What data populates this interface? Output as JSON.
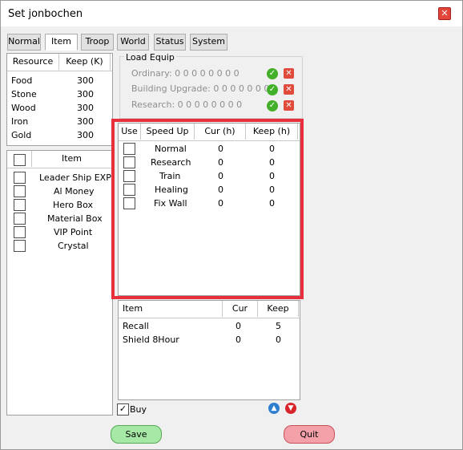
{
  "window": {
    "title": "Set jonbochen"
  },
  "tabs": [
    "Normal",
    "Item",
    "Troop",
    "World",
    "Status",
    "System"
  ],
  "resources": {
    "headers": [
      "Resource",
      "Keep (K)"
    ],
    "rows": [
      {
        "name": "Food",
        "keep": "300"
      },
      {
        "name": "Stone",
        "keep": "300"
      },
      {
        "name": "Wood",
        "keep": "300"
      },
      {
        "name": "Iron",
        "keep": "300"
      },
      {
        "name": "Gold",
        "keep": "300"
      }
    ]
  },
  "items_list": {
    "header": "Item",
    "rows": [
      "Leader Ship EXP",
      "Al Money",
      "Hero Box",
      "Material Box",
      "VIP Point",
      "Crystal"
    ]
  },
  "load_equip": {
    "label": "Load Equip",
    "rows": [
      {
        "label": "Ordinary: 0 0 0 0 0 0 0 0"
      },
      {
        "label": "Building Upgrade: 0 0 0 0 0 0 0"
      },
      {
        "label": "Research: 0 0 0 0 0 0 0 0"
      }
    ]
  },
  "speedup": {
    "headers": [
      "Use",
      "Speed Up",
      "Cur (h)",
      "Keep (h)"
    ],
    "rows": [
      {
        "name": "Normal",
        "cur": "0",
        "keep": "0"
      },
      {
        "name": "Research",
        "cur": "0",
        "keep": "0"
      },
      {
        "name": "Train",
        "cur": "0",
        "keep": "0"
      },
      {
        "name": "Healing",
        "cur": "0",
        "keep": "0"
      },
      {
        "name": "Fix Wall",
        "cur": "0",
        "keep": "0"
      }
    ]
  },
  "consumables": {
    "headers": [
      "Item",
      "Cur",
      "Keep"
    ],
    "rows": [
      {
        "name": "Recall",
        "cur": "0",
        "keep": "5"
      },
      {
        "name": "Shield 8Hour",
        "cur": "0",
        "keep": "0"
      }
    ]
  },
  "buy_label": "Buy",
  "buttons": {
    "save": "Save",
    "quit": "Quit"
  },
  "icons": {
    "close": "close-icon",
    "ok": "check-icon",
    "remove": "cross-icon",
    "up": "arrow-up-icon",
    "down": "arrow-down-icon"
  },
  "colors": {
    "highlight": "#e8303c",
    "save": "#a6e8a6",
    "quit": "#f4a0a8"
  }
}
